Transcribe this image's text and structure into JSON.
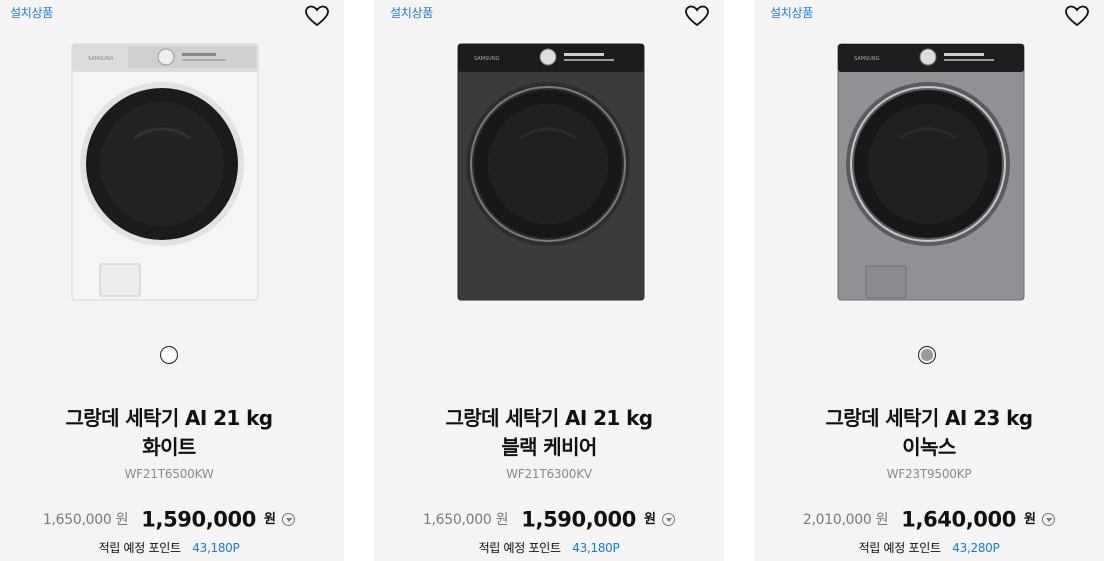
{
  "products": [
    {
      "badge": "설치상품",
      "title_line1": "그랑데 세탁기 AI 21 kg",
      "title_line2": "화이트",
      "model": "WF21T6500KW",
      "original_price": "1,650,000 원",
      "sale_price": "1,590,000",
      "currency": "원",
      "points_label": "적립 예정 포인트",
      "points_value": "43,180P",
      "color_swatch": "#ffffff",
      "body_color": "#f2f2f2"
    },
    {
      "badge": "설치상품",
      "title_line1": "그랑데 세탁기 AI 21 kg",
      "title_line2": "블랙 케비어",
      "model": "WF21T6300KV",
      "original_price": "1,650,000 원",
      "sale_price": "1,590,000",
      "currency": "원",
      "points_label": "적립 예정 포인트",
      "points_value": "43,180P",
      "color_swatch": "#2b2b2b",
      "body_color": "#3a3a3c"
    },
    {
      "badge": "설치상품",
      "title_line1": "그랑데 세탁기 AI 23 kg",
      "title_line2": "이녹스",
      "model": "WF23T9500KP",
      "original_price": "2,010,000 원",
      "sale_price": "1,640,000",
      "currency": "원",
      "points_label": "적립 예정 포인트",
      "points_value": "43,280P",
      "color_swatch": "#9a9a9a",
      "body_color": "#8e8f92"
    }
  ]
}
